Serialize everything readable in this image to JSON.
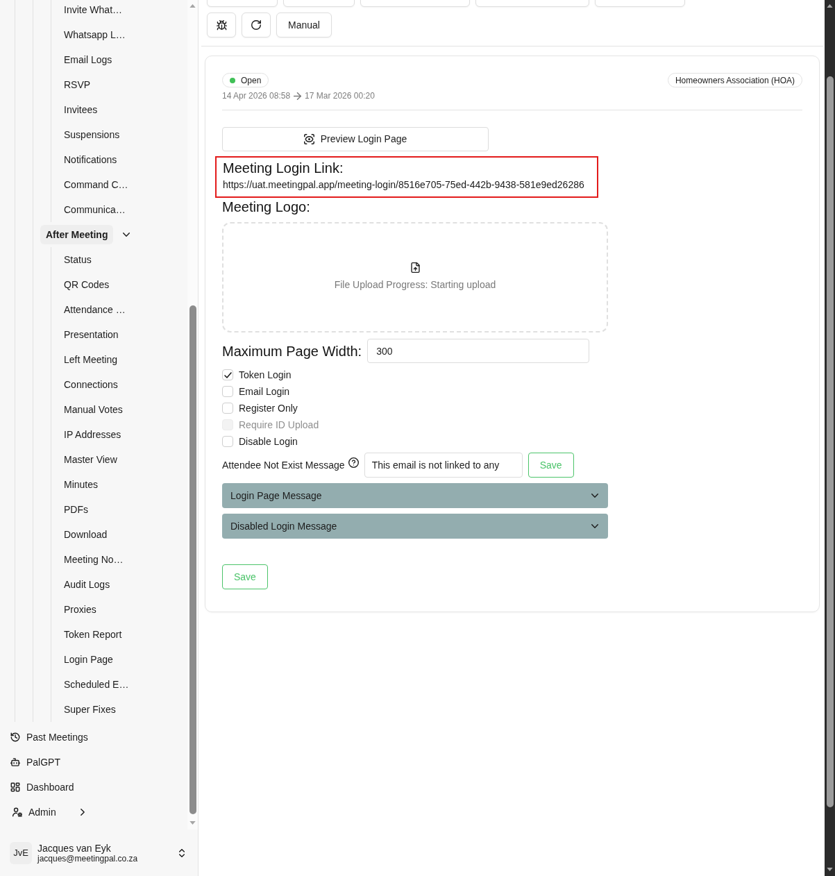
{
  "sidebar": {
    "upper_items": [
      {
        "label": "Invite What…"
      },
      {
        "label": "Whatsapp L…"
      },
      {
        "label": "Email Logs"
      },
      {
        "label": "RSVP"
      },
      {
        "label": "Invitees"
      },
      {
        "label": "Suspensions"
      },
      {
        "label": "Notifications"
      },
      {
        "label": "Command C…"
      },
      {
        "label": "Communica…"
      }
    ],
    "groups": [
      {
        "label": "After Meeting",
        "expanded": true,
        "children": [
          {
            "label": "Status"
          },
          {
            "label": "QR Codes"
          },
          {
            "label": "Attendance …"
          },
          {
            "label": "Presentation"
          },
          {
            "label": "Left Meeting"
          },
          {
            "label": "Connections"
          },
          {
            "label": "Manual Votes"
          },
          {
            "label": "IP Addresses"
          },
          {
            "label": "Master View"
          },
          {
            "label": "Minutes"
          },
          {
            "label": "PDFs"
          },
          {
            "label": "Download"
          },
          {
            "label": "Meeting No…"
          },
          {
            "label": "Audit Logs"
          },
          {
            "label": "Proxies"
          },
          {
            "label": "Token Report"
          },
          {
            "label": "Login Page"
          },
          {
            "label": "Scheduled E…"
          },
          {
            "label": "Super Fixes"
          }
        ]
      }
    ],
    "links": [
      {
        "label": "Past Meetings",
        "kind": "link"
      },
      {
        "label": "PalGPT",
        "kind": "link"
      },
      {
        "label": "Dashboard",
        "kind": "link"
      },
      {
        "label": "Admin",
        "kind": "submenu"
      }
    ],
    "user": {
      "initials": "JvE",
      "name": "Jacques van Eyk",
      "email": "jacques@meetingpal.co.za"
    }
  },
  "toolbar": {
    "manual_button": "Manual"
  },
  "meeting": {
    "status": {
      "label": "Open",
      "kind": "open"
    },
    "category": "Homeowners Association (HOA)",
    "start": "14 Apr 2026 08:58",
    "end": "17 Mar 2026 00:20"
  },
  "login_page": {
    "preview_button": "Preview Login Page",
    "login_link": {
      "heading": "Meeting Login Link:",
      "url": "https://uat.meetingpal.app/meeting-login/8516e705-75ed-442b-9438-581e9ed26286",
      "highlighted": true
    },
    "logo": {
      "heading": "Meeting Logo:",
      "upload_status": "File Upload Progress: Starting upload"
    },
    "max_width": {
      "label": "Maximum Page Width:",
      "value": "300"
    },
    "options": [
      {
        "label": "Token Login",
        "checked": true,
        "disabled": false
      },
      {
        "label": "Email Login",
        "checked": false,
        "disabled": false
      },
      {
        "label": "Register Only",
        "checked": false,
        "disabled": false
      },
      {
        "label": "Require ID Upload",
        "checked": false,
        "disabled": true
      },
      {
        "label": "Disable Login",
        "checked": false,
        "disabled": false
      }
    ],
    "attendee_message": {
      "label": "Attendee Not Exist Message",
      "value": "This email is not linked to any",
      "button": "Save"
    },
    "accordions": [
      {
        "label": "Login Page Message",
        "expanded": false
      },
      {
        "label": "Disabled Login Message",
        "expanded": false
      }
    ],
    "save_button": "Save"
  }
}
